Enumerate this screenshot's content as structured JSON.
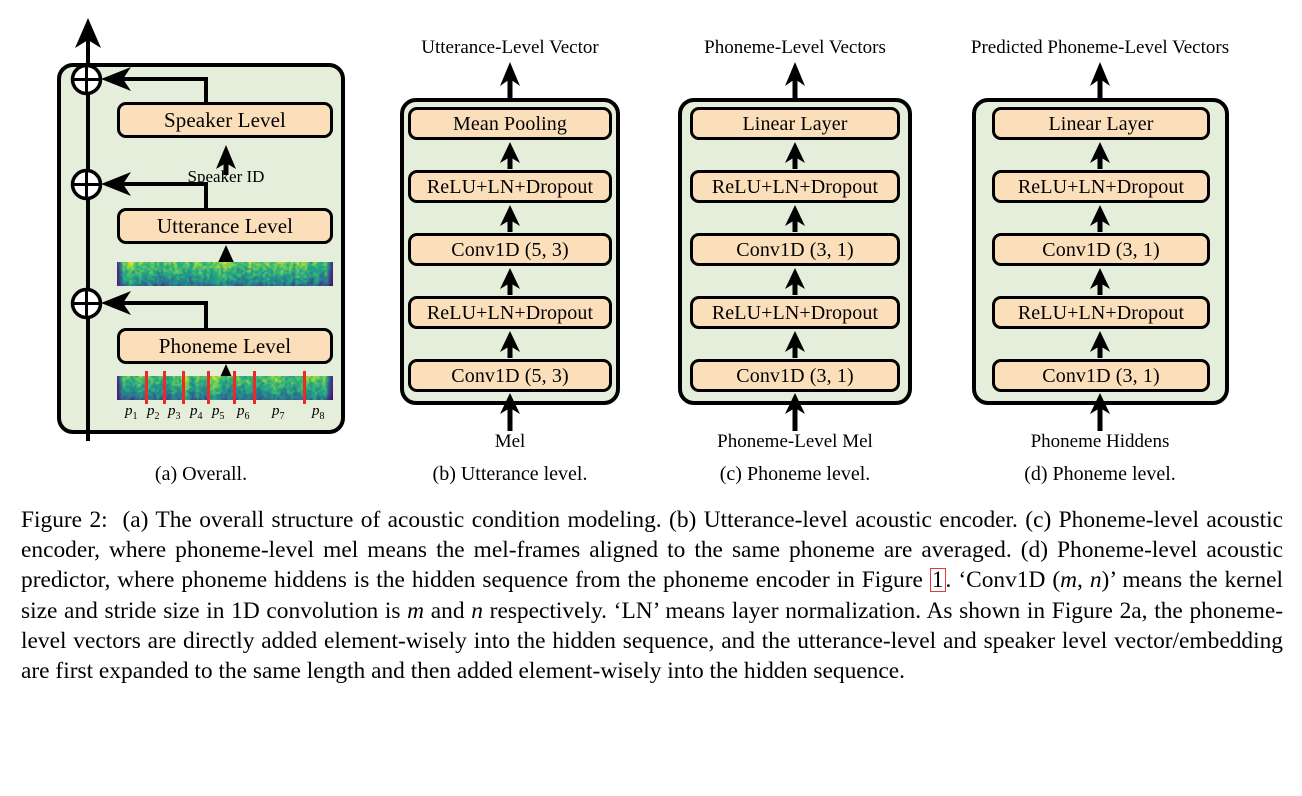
{
  "figure": {
    "label": "Figure 2:",
    "caption_parts": {
      "p1": "(a) The overall structure of acoustic condition modeling. (b) Utterance-level acoustic encoder. (c) Phoneme-level acoustic encoder, where phoneme-level mel means the mel-frames aligned to the same phoneme are averaged. (d) Phoneme-level acoustic predictor, where phoneme hiddens is the hidden sequence from the phoneme encoder in Figure ",
      "ref": "1",
      "p2": ". ‘Conv1D (",
      "m1": "m",
      "p3": ", ",
      "n1": "n",
      "p4": ")’ means the kernel size and stride size in 1D convolution is ",
      "m2": "m",
      "p5": " and ",
      "n2": "n",
      "p6": " respectively. ‘LN’ means layer normalization. As shown in Figure 2a, the phoneme-level vectors are directly added element-wisely into the hidden sequence, and the utterance-level and speaker level vector/embedding are first expanded to the same length and then added element-wisely into the hidden sequence."
    }
  },
  "colors": {
    "panel_bg": "#e4eedb",
    "block_fill": "#fbdfbb",
    "stroke": "#000000",
    "boundary_red": "#ee2a24",
    "ref_box_red": "#e03b3b"
  },
  "subcaptions": [
    {
      "id": "a",
      "text": "(a) Overall."
    },
    {
      "id": "b",
      "text": "(b) Utterance level."
    },
    {
      "id": "c",
      "text": "(c) Phoneme level."
    },
    {
      "id": "d",
      "text": "(d) Phoneme level."
    }
  ],
  "panel_a": {
    "blocks": [
      {
        "label": "Speaker Level"
      },
      {
        "label": "Utterance Level"
      },
      {
        "label": "Phoneme Level"
      }
    ],
    "speaker_id_label": "Speaker ID",
    "phoneme_labels": [
      "p",
      "p",
      "p",
      "p",
      "p",
      "p",
      "p",
      "p"
    ],
    "phoneme_indices": [
      "1",
      "2",
      "3",
      "4",
      "5",
      "6",
      "7",
      "8"
    ],
    "adder_symbol": "⊕",
    "adder_count": 3
  },
  "panel_b": {
    "top_label": "Utterance-Level Vector",
    "bottom_label": "Mel",
    "blocks": [
      {
        "label": "Mean Pooling"
      },
      {
        "label": "ReLU+LN+Dropout"
      },
      {
        "label": "Conv1D (5, 3)"
      },
      {
        "label": "ReLU+LN+Dropout"
      },
      {
        "label": "Conv1D (5, 3)"
      }
    ]
  },
  "panel_c": {
    "top_label": "Phoneme-Level Vectors",
    "bottom_label": "Phoneme-Level Mel",
    "blocks": [
      {
        "label": "Linear Layer"
      },
      {
        "label": "ReLU+LN+Dropout"
      },
      {
        "label": "Conv1D (3, 1)"
      },
      {
        "label": "ReLU+LN+Dropout"
      },
      {
        "label": "Conv1D (3, 1)"
      }
    ]
  },
  "panel_d": {
    "top_label": "Predicted Phoneme-Level Vectors",
    "bottom_label": "Phoneme Hiddens",
    "blocks": [
      {
        "label": "Linear Layer"
      },
      {
        "label": "ReLU+LN+Dropout"
      },
      {
        "label": "Conv1D (3, 1)"
      },
      {
        "label": "ReLU+LN+Dropout"
      },
      {
        "label": "Conv1D (3, 1)"
      }
    ]
  }
}
